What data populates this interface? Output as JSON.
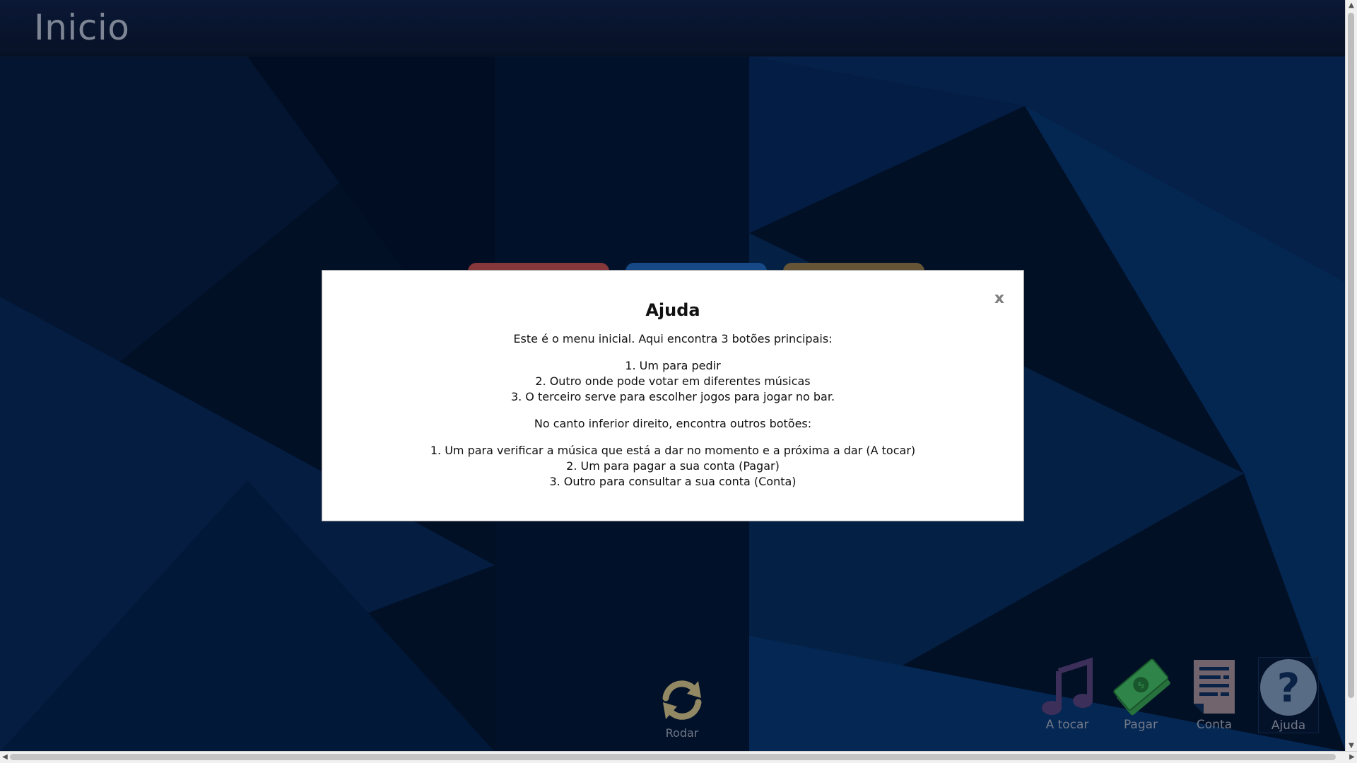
{
  "header": {
    "title": "Inicio"
  },
  "modal": {
    "title": "Ajuda",
    "close_label": "x",
    "intro": "Este é o menu inicial. Aqui encontra 3 botões principais:",
    "main_buttons": [
      "1. Um para pedir",
      "2. Outro onde pode votar em diferentes músicas",
      "3. O terceiro serve para escolher jogos para jogar no bar."
    ],
    "other_intro": "No canto inferior direito, encontra outros botões:",
    "other_buttons": [
      "1. Um para verificar a música que está a dar no momento e a próxima a dar (A tocar)",
      "2. Um para pagar a sua conta (Pagar)",
      "3. Outro para consultar a sua conta (Conta)"
    ]
  },
  "rodar": {
    "label": "Rodar",
    "icon": "rotate-icon",
    "color": "#b3a67a"
  },
  "bottom_bar": [
    {
      "label": "A tocar",
      "icon": "music-note-icon",
      "color": "#4a3a6e"
    },
    {
      "label": "Pagar",
      "icon": "money-icon",
      "color": "#2f8a4a"
    },
    {
      "label": "Conta",
      "icon": "receipt-icon",
      "color": "#8a7a86"
    },
    {
      "label": "Ajuda",
      "icon": "help-icon",
      "color": "#6d84a3"
    }
  ],
  "colors": {
    "tab_red": "#a44447",
    "tab_blue": "#1d5aa5",
    "tab_gold": "#7c6842",
    "background": "#041a3a"
  }
}
